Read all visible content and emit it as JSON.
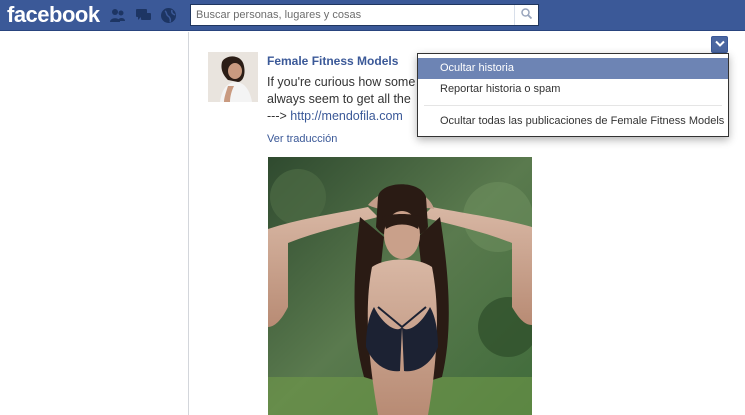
{
  "topbar": {
    "logo": "facebook",
    "icons": [
      "friend-requests-icon",
      "messages-icon",
      "notifications-icon"
    ],
    "search_placeholder": "Buscar personas, lugares y cosas"
  },
  "story": {
    "actor_name": "Female Fitness Models",
    "message_line1": "If you're curious how some",
    "message_line2": "always seem to get all the",
    "message_line3_prefix": "---> ",
    "message_link": "http://mendofila.com",
    "translate_link": "Ver traducción"
  },
  "menu": {
    "items": [
      {
        "label": "Ocultar historia",
        "active": true
      },
      {
        "label": "Reportar historia o spam",
        "active": false
      },
      {
        "label": "Ocultar todas las publicaciones de Female Fitness Models",
        "active": false
      }
    ]
  },
  "colors": {
    "brand_blue": "#3b5998",
    "menu_highlight": "#6d84b4",
    "link_blue": "#3b5998"
  }
}
